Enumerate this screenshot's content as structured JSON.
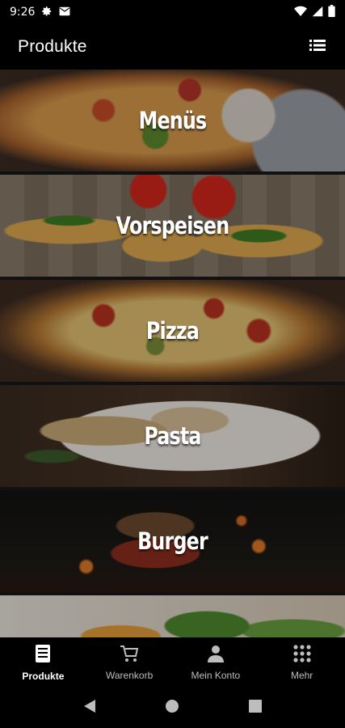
{
  "status_bar": {
    "time": "9:26"
  },
  "app_bar": {
    "title": "Produkte"
  },
  "categories": [
    {
      "label": "Menüs"
    },
    {
      "label": "Vorspeisen"
    },
    {
      "label": "Pizza"
    },
    {
      "label": "Pasta"
    },
    {
      "label": "Burger"
    },
    {
      "label": ""
    }
  ],
  "bottom_nav": {
    "items": [
      {
        "label": "Produkte",
        "icon": "menu-card-icon",
        "active": true
      },
      {
        "label": "Warenkorb",
        "icon": "cart-icon",
        "active": false
      },
      {
        "label": "Mein Konto",
        "icon": "person-icon",
        "active": false
      },
      {
        "label": "Mehr",
        "icon": "grid-icon",
        "active": false
      }
    ]
  },
  "colors": {
    "background": "#000000",
    "active_nav": "#ffffff",
    "inactive_nav": "#bdbdbd"
  }
}
